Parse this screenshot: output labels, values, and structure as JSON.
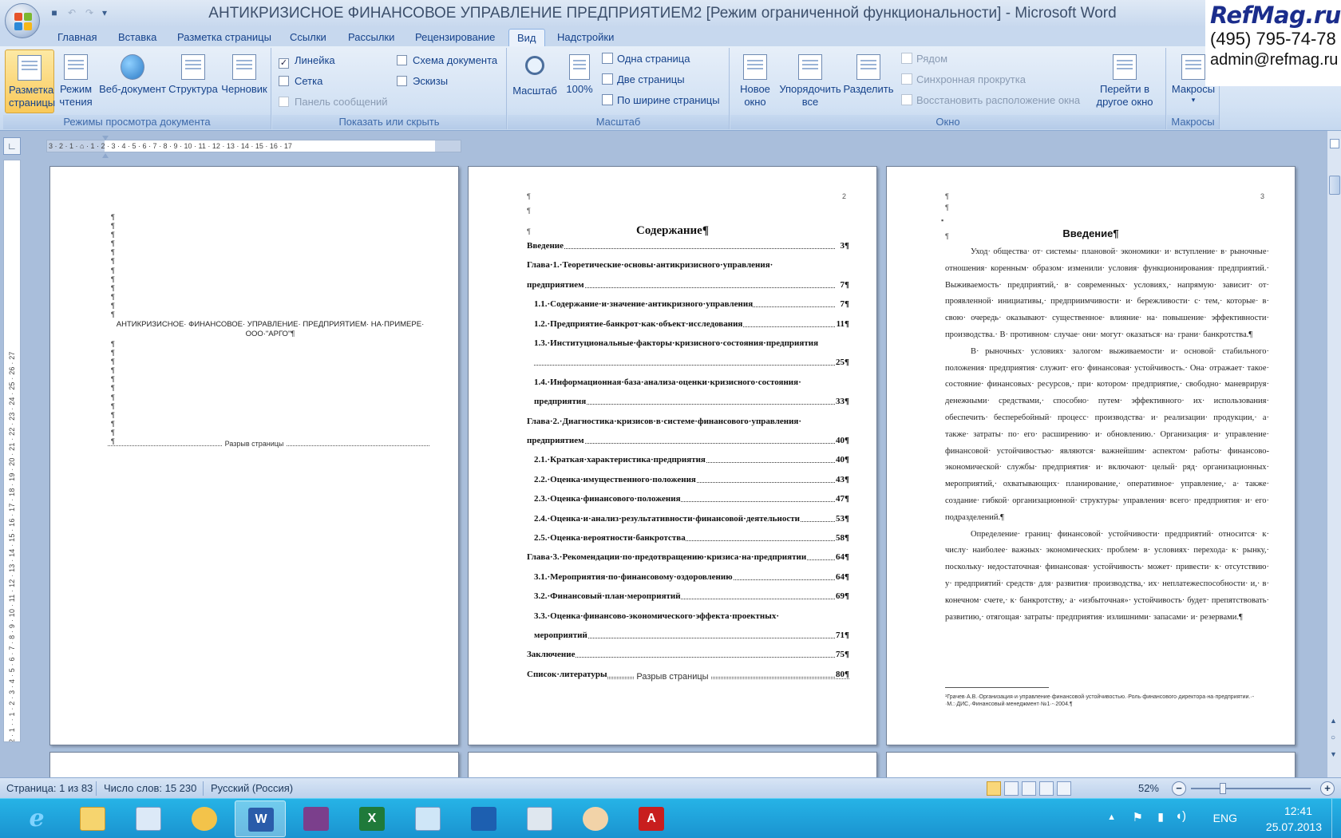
{
  "titlebar": {
    "title": "АНТИКРИЗИСНОЕ ФИНАНСОВОЕ УПРАВЛЕНИЕ ПРЕДПРИЯТИЕМ2 [Режим ограниченной функциональности] - Microsoft Word"
  },
  "watermark": {
    "site": "RefMag.ru",
    "phone": "(495) 795-74-78",
    "email": "admin@refmag.ru"
  },
  "tabs": [
    "Главная",
    "Вставка",
    "Разметка страницы",
    "Ссылки",
    "Рассылки",
    "Рецензирование",
    "Вид",
    "Надстройки"
  ],
  "ribbon": {
    "views": {
      "label": "Режимы просмотра документа",
      "buttons": [
        "Разметка страницы",
        "Режим чтения",
        "Веб-документ",
        "Структура",
        "Черновик"
      ]
    },
    "show": {
      "label": "Показать или скрыть",
      "ruler": "Линейка",
      "grid": "Сетка",
      "msgbar": "Панель сообщений",
      "docmap": "Схема документа",
      "thumbs": "Эскизы"
    },
    "zoom": {
      "label": "Масштаб",
      "zoom_btn": "Масштаб",
      "hundred": "100%",
      "one_page": "Одна страница",
      "two_pages": "Две страницы",
      "page_width": "По ширине страницы"
    },
    "window": {
      "label": "Окно",
      "new_window": "Новое окно",
      "arrange_all": "Упорядочить все",
      "split": "Разделить",
      "side_by_side": "Рядом",
      "sync_scroll": "Синхронная прокрутка",
      "reset_pos": "Восстановить расположение окна",
      "switch": "Перейти в другое окно"
    },
    "macros": {
      "label": "Макросы",
      "btn": "Макросы"
    }
  },
  "ruler": {
    "horizontal": "3 · 2 · 1 · ⌂ · 1 · 2 · 3 · 4 · 5 · 6 · 7 · 8 · 9 · 10 · 11 · 12 · 13 · 14 · 15 · 16 · 17",
    "vertical": "2 · 1 · · 1 · 2 · 3 · 4 · 5 · 6 · 7 · 8 · 9 · 10 · 11 · 12 · 13 · 14 · 15 · 16 · 17 · 18 · 19 · 20 · 21 · 22 · 23 · 24 · 25 · 26 · 27"
  },
  "page1": {
    "title": "АНТИКРИЗИСНОЕ· ФИНАНСОВОЕ· УПРАВЛЕНИЕ· ПРЕДПРИЯТИЕМ· НА·ПРИМЕРЕ· ООО·\"АРГО\"¶",
    "page_break": "Разрыв страницы"
  },
  "page2": {
    "number": "2",
    "title": "Содержание¶",
    "page_break": "Разрыв страницы",
    "toc": [
      {
        "text": "Введение",
        "page": "3¶",
        "indent": 0
      },
      {
        "text": "Глава·1.·Теоретические·основы·антикризисного·управления·",
        "page": "",
        "indent": 0
      },
      {
        "text": "предприятием",
        "page": "7¶",
        "indent": 0
      },
      {
        "text": "1.1.·Содержание·и·значение·антикризного·управления",
        "page": "7¶",
        "indent": 1
      },
      {
        "text": "1.2.·Предприятие-банкрот·как·объект·исследования",
        "page": "11¶",
        "indent": 1
      },
      {
        "text": "1.3.·Институциональные·факторы·кризисного·состояния·предприятия",
        "page": "",
        "indent": 1
      },
      {
        "text": "",
        "page": "25¶",
        "indent": 1
      },
      {
        "text": "1.4.·Информационная·база·анализа·оценки·кризисного·состояния·",
        "page": "",
        "indent": 1
      },
      {
        "text": "предприятия",
        "page": "33¶",
        "indent": 1
      },
      {
        "text": "Глава·2.·Диагностика·кризисов·в·системе·финансового·управления·",
        "page": "",
        "indent": 0
      },
      {
        "text": "предприятием",
        "page": "40¶",
        "indent": 0
      },
      {
        "text": "2.1.·Краткая·характеристика·предприятия",
        "page": "40¶",
        "indent": 1
      },
      {
        "text": "2.2.·Оценка·имущественного·положения",
        "page": "43¶",
        "indent": 1
      },
      {
        "text": "2.3.·Оценка·финансового·положения",
        "page": "47¶",
        "indent": 1
      },
      {
        "text": "2.4.·Оценка·и·анализ·результативности·финансовой·деятельности",
        "page": "53¶",
        "indent": 1
      },
      {
        "text": "2.5.·Оценка·вероятности·банкротства",
        "page": "58¶",
        "indent": 1
      },
      {
        "text": "Глава·3.·Рекомендации·по·предотвращению·кризиса·на·предприятии",
        "page": "64¶",
        "indent": 0
      },
      {
        "text": "3.1.·Мероприятия·по·финансовому·оздоровлению",
        "page": "64¶",
        "indent": 1
      },
      {
        "text": "3.2.·Финансовый·план·мероприятий",
        "page": "69¶",
        "indent": 1
      },
      {
        "text": "3.3.·Оценка·финансово-экономического·эффекта·проектных·",
        "page": "",
        "indent": 1
      },
      {
        "text": "мероприятий",
        "page": "71¶",
        "indent": 1
      },
      {
        "text": "Заключение",
        "page": "75¶",
        "indent": 0
      },
      {
        "text": "Список·литературы",
        "page": "80¶",
        "indent": 0
      }
    ]
  },
  "page3": {
    "number": "3",
    "title": "Введение¶",
    "paragraphs": [
      "Уход· общества· от· системы· плановой· экономики· и· вступление· в· рыночные· отношения· коренным· образом· изменили· условия· функционирования· предприятий.· Выживаемость· предприятий,· в· современных· условиях,· напрямую· зависит· от· проявленной· инициативы,· предприимчивости· и· бережливости· с· тем,· которые· в· свою· очередь· оказывают· существенное· влияние· на· повышение· эффективности· производства.· В· противном· случае· они· могут· оказаться· на· грани· банкротства.¶",
      "В· рыночных· условиях· залогом· выживаемости· и· основой· стабильного· положения· предприятия· служит· его· финансовая· устойчивость.· Она· отражает· такое· состояние· финансовых· ресурсов,· при· котором· предприятие,· свободно· маневрируя· денежными· средствами,· способно· путем· эффективного· их· использования· обеспечить· бесперебойный· процесс· производства· и· реализации· продукции,· а· также· затраты· по· его· расширению· и· обновлению.· Организация· и· управление· финансовой· устойчивостью· являются· важнейшим· аспектом· работы· финансово-экономической· службы· предприятия· и· включают· целый· ряд· организационных· мероприятий,· охватывающих· планирование,· оперативное· управление,· а· также· создание· гибкой· организационной· структуры· управления· всего· предприятия· и· его· подразделений.¶",
      "Определение· границ· финансовой· устойчивости· предприятий· относится· к· числу· наиболее· важных· экономических· проблем· в· условиях· перехода· к· рынку,· поскольку· недостаточная· финансовая· устойчивость· может· привести· к· отсутствию· у· предприятий· средств· для· развития· производства,· их· неплатежеспособности· и,· в· конечном· счете,· к· банкротству,· а· «избыточная»· устойчивость· будет· препятствовать· развитию,· отягощая· затраты· предприятия· излишними· запасами· и· резервами.¶"
    ],
    "footnote": "¹Грачев·А.В.·Организация·и·управление·финансовой·устойчивостью.·Роль·финансового·директора·на·предприятии.·-·М.:·ДИС,·Финансовый·менеджмент·№1·-·2004.¶"
  },
  "status": {
    "page": "Страница: 1 из 83",
    "words": "Число слов: 15 230",
    "lang": "Русский (Россия)",
    "zoom": "52%"
  },
  "taskbar": {
    "lang": "ENG",
    "time": "12:41",
    "date": "25.07.2013"
  }
}
